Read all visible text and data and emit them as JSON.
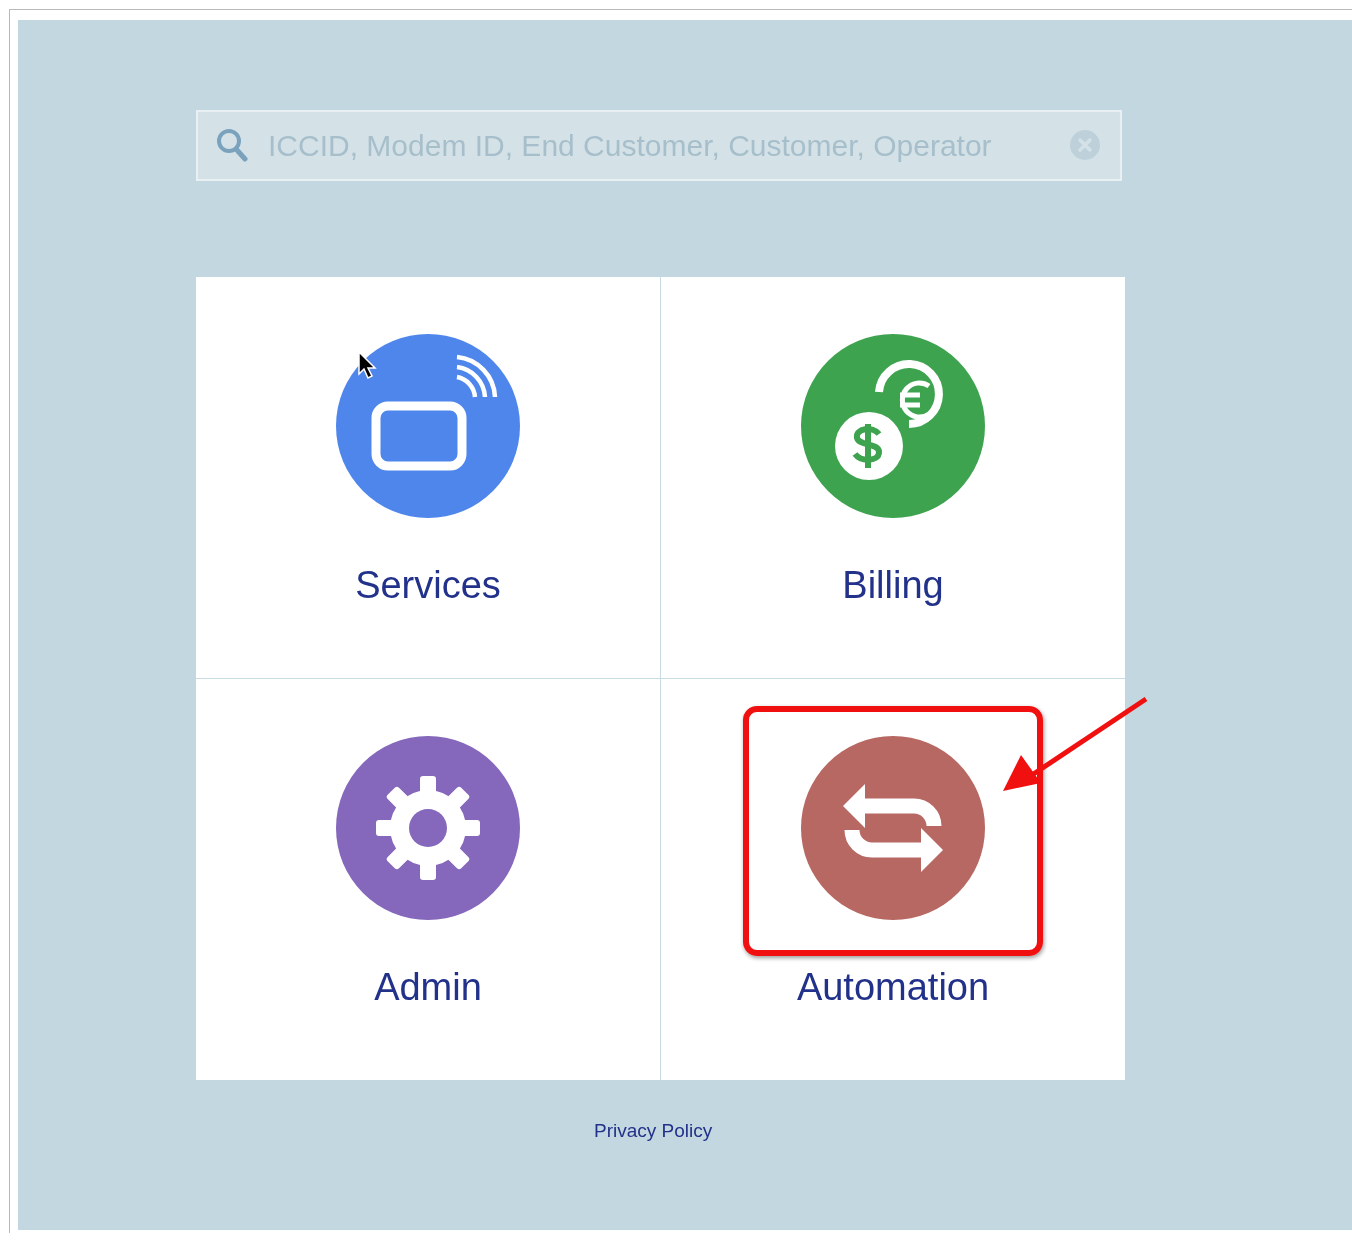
{
  "search": {
    "placeholder": "ICCID, Modem ID, End Customer, Customer, Operator"
  },
  "tiles": [
    {
      "label": "Services",
      "kind": "device",
      "color": "#4f86ec",
      "highlighted": false
    },
    {
      "label": "Billing",
      "kind": "currency",
      "color": "#3da34f",
      "highlighted": false
    },
    {
      "label": "Admin",
      "kind": "gear",
      "color": "#8567bb",
      "highlighted": false
    },
    {
      "label": "Automation",
      "kind": "exchange",
      "color": "#b76862",
      "highlighted": true
    }
  ],
  "footer": {
    "link": "Privacy Policy"
  }
}
